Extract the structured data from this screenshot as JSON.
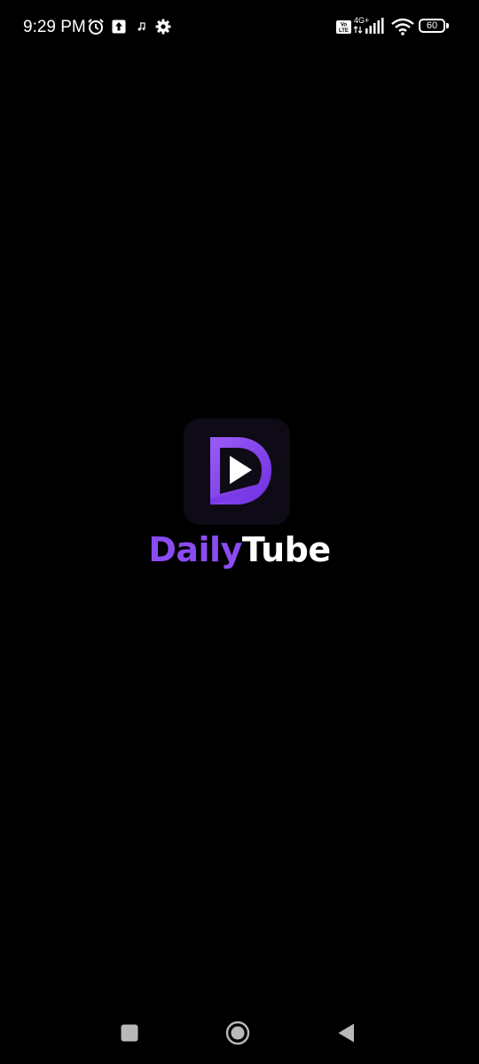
{
  "status_bar": {
    "time": "9:29 PM",
    "network": "4G+",
    "battery_level": "60",
    "icons": [
      "alarm-icon",
      "upload-icon",
      "music-note-icon",
      "settings-gear-icon",
      "volte-icon",
      "signal-icon",
      "wifi-icon",
      "battery-icon"
    ]
  },
  "splash": {
    "app_name_part1": "Daily",
    "app_name_part2": "Tube",
    "logo_icon": "dailytube-logo-icon"
  },
  "nav_bar": {
    "buttons": [
      "recents-button",
      "home-button",
      "back-button"
    ]
  },
  "colors": {
    "background": "#000000",
    "brand_purple": "#8a4cf0",
    "logo_tile": "#0f0b16"
  }
}
